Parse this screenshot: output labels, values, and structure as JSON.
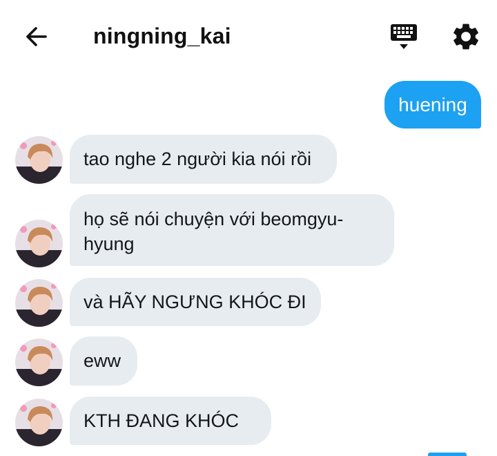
{
  "header": {
    "title": "ningning_kai",
    "back_icon": "arrow-left-icon",
    "keyboard_icon": "keyboard-icon",
    "settings_icon": "gear-icon"
  },
  "colors": {
    "accent": "#1da1f2",
    "incoming_bubble": "#e6ecf0",
    "text": "#14171a"
  },
  "messages": [
    {
      "direction": "outgoing",
      "text": "huening"
    },
    {
      "direction": "incoming",
      "text": "tao nghe 2 người kia nói rồi"
    },
    {
      "direction": "incoming",
      "text": "họ sẽ nói chuyện với beomgyu-hyung"
    },
    {
      "direction": "incoming",
      "text": "và HÃY NGƯNG KHÓC ĐI"
    },
    {
      "direction": "incoming",
      "text": "eww"
    },
    {
      "direction": "incoming",
      "text": "KTH ĐANG KHÓC"
    }
  ]
}
